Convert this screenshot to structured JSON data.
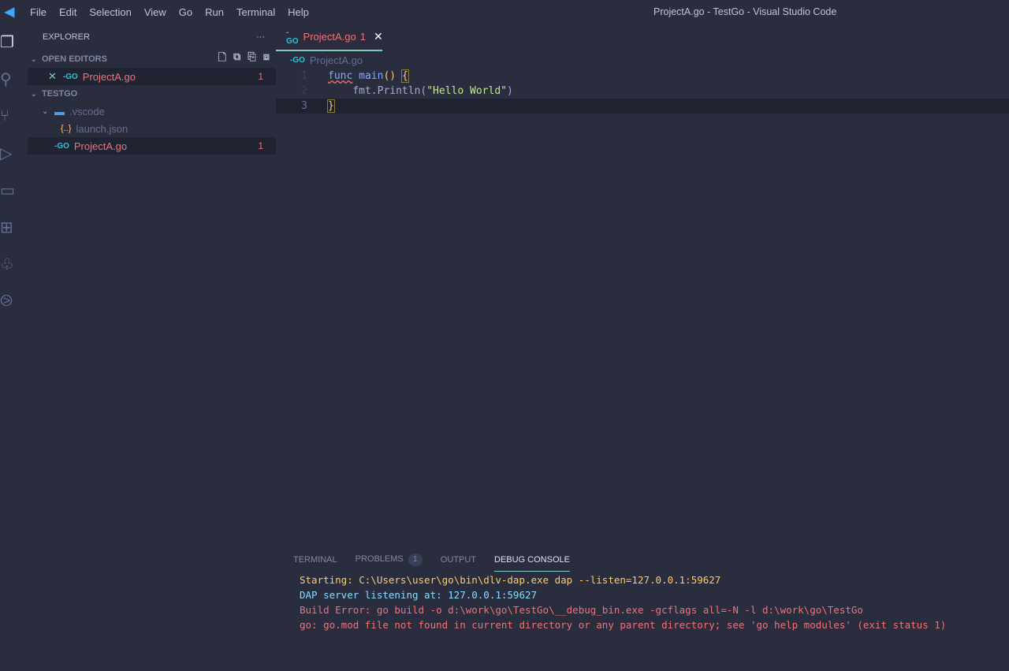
{
  "menu": [
    "File",
    "Edit",
    "Selection",
    "View",
    "Go",
    "Run",
    "Terminal",
    "Help"
  ],
  "window_title": "ProjectA.go - TestGo - Visual Studio Code",
  "explorer": {
    "title": "EXPLORER",
    "more": "···",
    "open_editors": {
      "label": "OPEN EDITORS",
      "items": [
        {
          "name": "ProjectA.go",
          "badge": "1"
        }
      ]
    },
    "workspace": {
      "label": "TESTGO",
      "folder": ".vscode",
      "folder_files": [
        "launch.json"
      ],
      "files": [
        {
          "name": "ProjectA.go",
          "badge": "1"
        }
      ]
    }
  },
  "editor": {
    "tab": {
      "name": "ProjectA.go",
      "badge": "1"
    },
    "breadcrumb": "ProjectA.go",
    "lines": [
      {
        "n": "1"
      },
      {
        "n": "2"
      },
      {
        "n": "3"
      }
    ],
    "code": {
      "func": "func",
      "main": "main",
      "parens": "()",
      "brace_open": "{",
      "pkg": "fmt.Println",
      "lp": "(",
      "str": "\"Hello World\"",
      "rp": ")",
      "brace_close": "}"
    }
  },
  "panel": {
    "tabs": [
      "TERMINAL",
      "PROBLEMS",
      "OUTPUT",
      "DEBUG CONSOLE"
    ],
    "problems_count": "1",
    "console": [
      {
        "text": "Starting: C:\\Users\\user\\go\\bin\\dlv-dap.exe dap --listen=127.0.0.1:59627",
        "color": "#ffcb6b"
      },
      {
        "text": "DAP server listening at: 127.0.0.1:59627",
        "color": "#89ddff"
      },
      {
        "text": "Build Error: go build -o d:\\work\\go\\TestGo\\__debug_bin.exe -gcflags all=-N -l d:\\work\\go\\TestGo",
        "color": "#f07178"
      },
      {
        "text": "go: go.mod file not found in current directory or any parent directory; see 'go help modules' (exit status 1)",
        "color": "#f07178"
      }
    ]
  }
}
